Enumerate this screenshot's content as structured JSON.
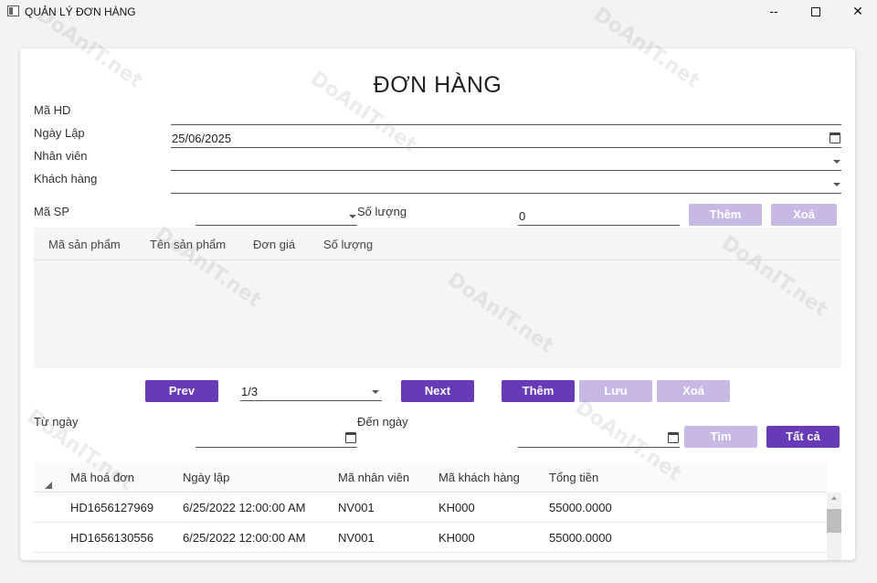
{
  "window": {
    "title": "QUẢN LÝ ĐƠN HÀNG",
    "minimize": "--"
  },
  "form": {
    "title": "ĐƠN HÀNG",
    "ma_hd_label": "Mã HD",
    "ma_hd_value": "",
    "ngay_lap_label": "Ngày Lập",
    "ngay_lap_value": "25/06/2025",
    "nhan_vien_label": "Nhân viên",
    "khach_hang_label": "Khách hàng",
    "ma_sp_label": "Mã SP",
    "so_luong_label": "Số lượng",
    "so_luong_value": "0",
    "add_item_button": "Thêm",
    "delete_item_button": "Xoá"
  },
  "detail_grid": {
    "columns": [
      "Mã sản phẩm",
      "Tên sản phẩm",
      "Đơn giá",
      "Số lượng"
    ]
  },
  "pager": {
    "prev": "Prev",
    "page": "1/3",
    "next": "Next",
    "add": "Thêm",
    "save": "Lưu",
    "delete": "Xoá"
  },
  "filter": {
    "from_label": "Từ ngày",
    "to_label": "Đến ngày",
    "search_button": "Tìm",
    "all_button": "Tất cả"
  },
  "orders_grid": {
    "columns": [
      "Mã hoá đơn",
      "Ngày lập",
      "Mã nhân viên",
      "Mã khách hàng",
      "Tổng tiền"
    ],
    "rows": [
      [
        "HD1656127969",
        "6/25/2022 12:00:00 AM",
        "NV001",
        "KH000",
        "55000.0000"
      ],
      [
        "HD1656130556",
        "6/25/2022 12:00:00 AM",
        "NV001",
        "KH000",
        "55000.0000"
      ]
    ]
  },
  "watermark_text": "DoAnIT.net",
  "colors": {
    "accent": "#673ab7",
    "accent_disabled": "#c8b8e6"
  }
}
